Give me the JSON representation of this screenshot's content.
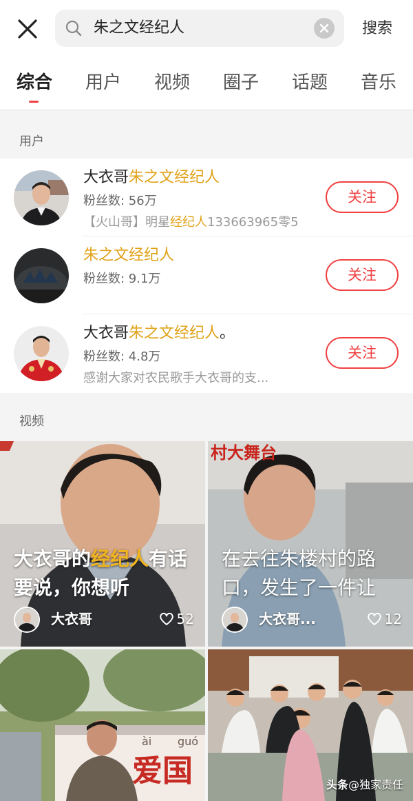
{
  "search": {
    "query": "朱之文经纪人",
    "submit_label": "搜索"
  },
  "tabs": [
    {
      "label": "综合",
      "active": true
    },
    {
      "label": "用户"
    },
    {
      "label": "视频"
    },
    {
      "label": "圈子"
    },
    {
      "label": "话题"
    },
    {
      "label": "音乐"
    }
  ],
  "users_section": {
    "title": "用户",
    "users": [
      {
        "name_prefix": "大衣哥",
        "name_highlight": "朱之文经纪人",
        "name_suffix": "",
        "fans": "粉丝数: 56万",
        "desc_prefix": "【火山哥】明星",
        "desc_highlight": "经纪人",
        "desc_suffix": "133663965零5",
        "follow_label": "关注"
      },
      {
        "name_prefix": "",
        "name_highlight": "朱之文经纪人",
        "name_suffix": "",
        "fans": "粉丝数: 9.1万",
        "follow_label": "关注"
      },
      {
        "name_prefix": "大衣哥",
        "name_highlight": "朱之文经纪人",
        "name_suffix": "。",
        "fans": "粉丝数: 4.8万",
        "desc": "感谢大家对农民歌手大衣哥的支...",
        "follow_label": "关注"
      }
    ]
  },
  "videos_section": {
    "title": "视频",
    "videos": [
      {
        "caption_prefix": "大衣哥的",
        "caption_highlight": "经纪人",
        "caption_suffix": "有话要说，你想听",
        "author": "大衣哥",
        "likes": "52",
        "banner": ""
      },
      {
        "caption_prefix": "在去往朱楼村的路口，发生了一件让",
        "caption_highlight": "",
        "caption_suffix": "",
        "author": "大衣哥...",
        "likes": "12",
        "banner": "村大舞台"
      },
      {
        "sign_pinyin_1": "ài",
        "sign_pinyin_2": "guó",
        "sign_text": "爱国"
      },
      {}
    ]
  },
  "watermark": {
    "brand": "头条",
    "handle": "@独家责任"
  },
  "colors": {
    "accent": "#f04142",
    "highlight": "#e0a21a"
  }
}
